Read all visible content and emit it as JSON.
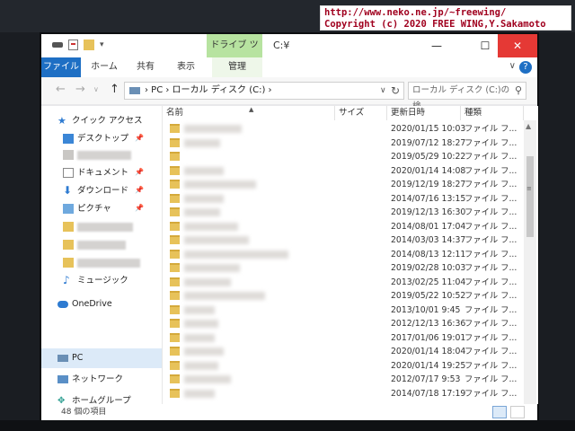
{
  "watermark": {
    "line1": "http://www.neko.ne.jp/~freewing/",
    "line2": "Copyright (c) 2020 FREE WING,Y.Sakamoto"
  },
  "titlebar": {
    "tool_tab": "ドライブ ツール",
    "title": "C:¥",
    "minimize": "—",
    "maximize": "☐",
    "close": "✕"
  },
  "ribbon": {
    "tabs": [
      "ファイル",
      "ホーム",
      "共有",
      "表示",
      "管理"
    ],
    "expand": "∨",
    "help": "?"
  },
  "address": {
    "back": "←",
    "forward": "→",
    "recent": "∨",
    "up": "↑",
    "path": "›  PC  ›  ローカル ディスク (C:)  ›",
    "dropdown": "∨",
    "refresh": "↻",
    "search_placeholder": "ローカル ディスク (C:)の検...",
    "search_icon": "search-icon"
  },
  "nav": {
    "quick_access": "クイック アクセス",
    "desktop": "デスクトップ",
    "documents": "ドキュメント",
    "downloads": "ダウンロード",
    "pictures": "ピクチャ",
    "music": "ミュージック",
    "onedrive": "OneDrive",
    "pc": "PC",
    "network": "ネットワーク",
    "homegroup": "ホームグループ",
    "pin_glyph": "📌",
    "expand_glyph": "›"
  },
  "columns": {
    "name": "名前",
    "size": "サイズ",
    "date": "更新日時",
    "type": "種類"
  },
  "rows": [
    {
      "date": "2020/01/15 10:03",
      "type": "ファイル フ..."
    },
    {
      "date": "2019/07/12 18:27",
      "type": "ファイル フ..."
    },
    {
      "date": "2019/05/29 10:22",
      "type": "ファイル フ..."
    },
    {
      "date": "2020/01/14 14:08",
      "type": "ファイル フ..."
    },
    {
      "date": "2019/12/19 18:27",
      "type": "ファイル フ..."
    },
    {
      "date": "2014/07/16 13:15",
      "type": "ファイル フ..."
    },
    {
      "date": "2019/12/13 16:30",
      "type": "ファイル フ..."
    },
    {
      "date": "2014/08/01 17:04",
      "type": "ファイル フ..."
    },
    {
      "date": "2014/03/03 14:37",
      "type": "ファイル フ..."
    },
    {
      "date": "2014/08/13 12:11",
      "type": "ファイル フ..."
    },
    {
      "date": "2019/02/28 10:03",
      "type": "ファイル フ..."
    },
    {
      "date": "2013/02/25 11:04",
      "type": "ファイル フ..."
    },
    {
      "date": "2019/05/22 10:52",
      "type": "ファイル フ..."
    },
    {
      "date": "2013/10/01 9:45",
      "type": "ファイル フ..."
    },
    {
      "date": "2012/12/13 16:36",
      "type": "ファイル フ..."
    },
    {
      "date": "2017/01/06 19:01",
      "type": "ファイル フ..."
    },
    {
      "date": "2020/01/14 18:04",
      "type": "ファイル フ..."
    },
    {
      "date": "2020/01/14 19:25",
      "type": "ファイル フ..."
    },
    {
      "date": "2012/07/17 9:53",
      "type": "ファイル フ..."
    },
    {
      "date": "2014/07/18 17:19",
      "type": "ファイル フ..."
    }
  ],
  "status": {
    "count": "48 個の項目"
  }
}
